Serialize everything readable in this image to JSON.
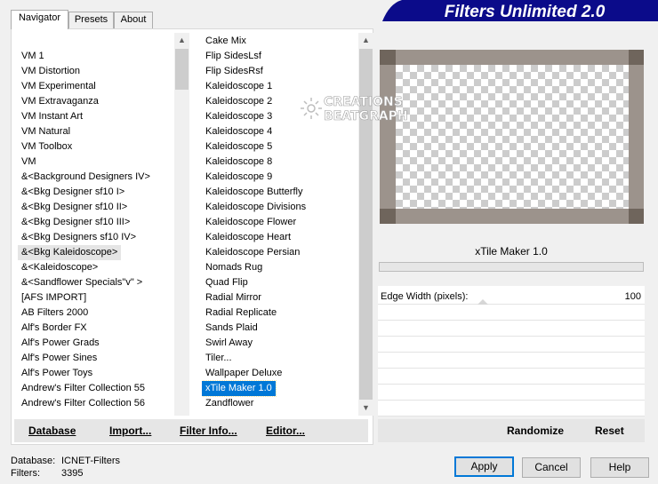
{
  "tabs": [
    "Navigator",
    "Presets",
    "About"
  ],
  "banner_title": "Filters Unlimited 2.0",
  "watermark": [
    "CREATIONS",
    "BEATGRAPH"
  ],
  "categories": [
    "VM 1",
    "VM Distortion",
    "VM Experimental",
    "VM Extravaganza",
    "VM Instant Art",
    "VM Natural",
    "VM Toolbox",
    "VM",
    "&<Background Designers IV>",
    "&<Bkg Designer sf10 I>",
    "&<Bkg Designer sf10 II>",
    "&<Bkg Designer sf10 III>",
    "&<Bkg Designers sf10 IV>",
    "&<Bkg Kaleidoscope>",
    "&<Kaleidoscope>",
    "&<Sandflower Specials\"v\" >",
    "[AFS IMPORT]",
    "AB Filters 2000",
    "Alf's Border FX",
    "Alf's Power Grads",
    "Alf's Power Sines",
    "Alf's Power Toys",
    "Andrew's Filter Collection 55",
    "Andrew's Filter Collection 56"
  ],
  "filters": [
    "Cake Mix",
    "Flip SidesLsf",
    "Flip SidesRsf",
    "Kaleidoscope 1",
    "Kaleidoscope 2",
    "Kaleidoscope 3",
    "Kaleidoscope 4",
    "Kaleidoscope 5",
    "Kaleidoscope 8",
    "Kaleidoscope 9",
    "Kaleidoscope Butterfly",
    "Kaleidoscope Divisions",
    "Kaleidoscope Flower",
    "Kaleidoscope Heart",
    "Kaleidoscope Persian",
    "Nomads Rug",
    "Quad Flip",
    "Radial Mirror",
    "Radial Replicate",
    "Sands Plaid",
    "Swirl Away",
    "Tiler...",
    "Wallpaper Deluxe",
    "xTile Maker 1.0",
    "Zandflower"
  ],
  "selected_filter": "xTile Maker 1.0",
  "highlighted_category": "&<Bkg Kaleidoscope>",
  "bottom_links": [
    "Database",
    "Import...",
    "Filter Info...",
    "Editor..."
  ],
  "filter_title": "xTile Maker 1.0",
  "param": {
    "label": "Edge Width (pixels):",
    "value": "100"
  },
  "right_buttons": [
    "Randomize",
    "Reset"
  ],
  "status": {
    "database_label": "Database:",
    "database_value": "ICNET-Filters",
    "filters_label": "Filters:",
    "filters_value": "3395"
  },
  "dialog_buttons": [
    "Apply",
    "Cancel",
    "Help"
  ],
  "colors": {
    "banner_bg": "#0b0b8a",
    "selection": "#0078d7",
    "frame": "#9c938c"
  }
}
